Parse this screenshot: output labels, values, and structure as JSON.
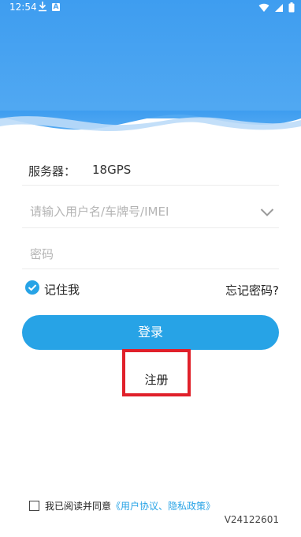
{
  "status": {
    "time": "12:54",
    "a_icon": "A"
  },
  "server": {
    "label": "服务器：",
    "value": "18GPS"
  },
  "username": {
    "placeholder": "请输入用户名/车牌号/IMEI"
  },
  "password": {
    "placeholder": "密码"
  },
  "remember": {
    "label": "记住我",
    "checked": true
  },
  "forgot": {
    "label": "忘记密码?"
  },
  "login": {
    "label": "登录"
  },
  "register": {
    "label": "注册"
  },
  "agreement": {
    "prefix": "我已阅读并同意",
    "link": "《用户协议、隐私政策》"
  },
  "version": "V24122601",
  "colors": {
    "accent": "#27a3e6",
    "header": "#4aa3f0",
    "highlight": "#e0202a"
  }
}
